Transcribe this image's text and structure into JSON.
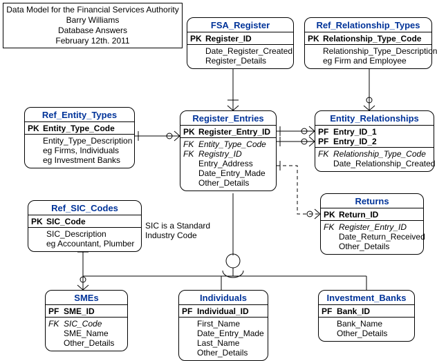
{
  "titleBox": {
    "line1": "Data Model for the Financial Services Authority",
    "line2": "Barry Williams",
    "line3": "Database Answers",
    "line4": "February 12th. 2011"
  },
  "note_sic": {
    "line1": "SIC is a Standard",
    "line2": "Industry Code"
  },
  "entities": {
    "fsa_register": {
      "title": "FSA_Register",
      "rows": [
        {
          "key": "PK",
          "keyClass": "",
          "attr": "Register_ID",
          "attrClass": "pk"
        },
        {
          "key": "",
          "keyClass": "",
          "attr": "Date_Register_Created",
          "attrClass": ""
        },
        {
          "key": "",
          "keyClass": "",
          "attr": "Register_Details",
          "attrClass": ""
        }
      ]
    },
    "ref_relationship_types": {
      "title": "Ref_Relationship_Types",
      "rows": [
        {
          "key": "PK",
          "keyClass": "",
          "attr": "Relationship_Type_Code",
          "attrClass": "pk"
        },
        {
          "key": "",
          "keyClass": "",
          "attr": "Relationship_Type_Description",
          "attrClass": ""
        },
        {
          "key": "",
          "keyClass": "",
          "attr": "eg Firm and Employee",
          "attrClass": ""
        }
      ]
    },
    "ref_entity_types": {
      "title": "Ref_Entity_Types",
      "rows": [
        {
          "key": "PK",
          "keyClass": "",
          "attr": "Entity_Type_Code",
          "attrClass": "pk"
        },
        {
          "key": "",
          "keyClass": "",
          "attr": "Entity_Type_Description",
          "attrClass": ""
        },
        {
          "key": "",
          "keyClass": "",
          "attr": "eg Firms, Individuals",
          "attrClass": ""
        },
        {
          "key": "",
          "keyClass": "",
          "attr": "eg Investment Banks",
          "attrClass": ""
        }
      ]
    },
    "register_entries": {
      "title": "Register_Entries",
      "rows": [
        {
          "key": "PK",
          "keyClass": "",
          "attr": "Register_Entry_ID",
          "attrClass": "pk"
        },
        {
          "key": "FK",
          "keyClass": "fk",
          "attr": "Entity_Type_Code",
          "attrClass": "fk"
        },
        {
          "key": "FK",
          "keyClass": "fk",
          "attr": "Registry_ID",
          "attrClass": "fk"
        },
        {
          "key": "",
          "keyClass": "",
          "attr": "Entry_Address",
          "attrClass": ""
        },
        {
          "key": "",
          "keyClass": "",
          "attr": "Date_Entry_Made",
          "attrClass": ""
        },
        {
          "key": "",
          "keyClass": "",
          "attr": "Other_Details",
          "attrClass": ""
        }
      ]
    },
    "entity_relationships": {
      "title": "Entity_Relationships",
      "rows": [
        {
          "key": "PF",
          "keyClass": "",
          "attr": "Entry_ID_1",
          "attrClass": "pk"
        },
        {
          "key": "PF",
          "keyClass": "",
          "attr": "Entry_ID_2",
          "attrClass": "pk"
        },
        {
          "key": "FK",
          "keyClass": "fk",
          "attr": "Relationship_Type_Code",
          "attrClass": "fk"
        },
        {
          "key": "",
          "keyClass": "",
          "attr": "Date_Relationship_Created",
          "attrClass": ""
        }
      ]
    },
    "ref_sic_codes": {
      "title": "Ref_SIC_Codes",
      "rows": [
        {
          "key": "PK",
          "keyClass": "",
          "attr": "SIC_Code",
          "attrClass": "pk"
        },
        {
          "key": "",
          "keyClass": "",
          "attr": "SIC_Description",
          "attrClass": ""
        },
        {
          "key": "",
          "keyClass": "",
          "attr": "eg Accountant, Plumber",
          "attrClass": ""
        }
      ]
    },
    "returns": {
      "title": "Returns",
      "rows": [
        {
          "key": "PK",
          "keyClass": "",
          "attr": "Return_ID",
          "attrClass": "pk"
        },
        {
          "key": "FK",
          "keyClass": "fk",
          "attr": "Register_Entry_ID",
          "attrClass": "fk"
        },
        {
          "key": "",
          "keyClass": "",
          "attr": "Date_Return_Received",
          "attrClass": ""
        },
        {
          "key": "",
          "keyClass": "",
          "attr": "Other_Details",
          "attrClass": ""
        }
      ]
    },
    "smes": {
      "title": "SMEs",
      "rows": [
        {
          "key": "PF",
          "keyClass": "",
          "attr": "SME_ID",
          "attrClass": "pk"
        },
        {
          "key": "FK",
          "keyClass": "fk",
          "attr": "SIC_Code",
          "attrClass": "fk"
        },
        {
          "key": "",
          "keyClass": "",
          "attr": "SME_Name",
          "attrClass": ""
        },
        {
          "key": "",
          "keyClass": "",
          "attr": "Other_Details",
          "attrClass": ""
        }
      ]
    },
    "individuals": {
      "title": "Individuals",
      "rows": [
        {
          "key": "PF",
          "keyClass": "",
          "attr": "Individual_ID",
          "attrClass": "pk"
        },
        {
          "key": "",
          "keyClass": "",
          "attr": "First_Name",
          "attrClass": ""
        },
        {
          "key": "",
          "keyClass": "",
          "attr": "Date_Entry_Made",
          "attrClass": ""
        },
        {
          "key": "",
          "keyClass": "",
          "attr": "Last_Name",
          "attrClass": ""
        },
        {
          "key": "",
          "keyClass": "",
          "attr": "Other_Details",
          "attrClass": ""
        }
      ]
    },
    "investment_banks": {
      "title": "Investment_Banks",
      "rows": [
        {
          "key": "PF",
          "keyClass": "",
          "attr": "Bank_ID",
          "attrClass": "pk"
        },
        {
          "key": "",
          "keyClass": "",
          "attr": "Bank_Name",
          "attrClass": ""
        },
        {
          "key": "",
          "keyClass": "",
          "attr": "Other_Details",
          "attrClass": ""
        }
      ]
    }
  }
}
